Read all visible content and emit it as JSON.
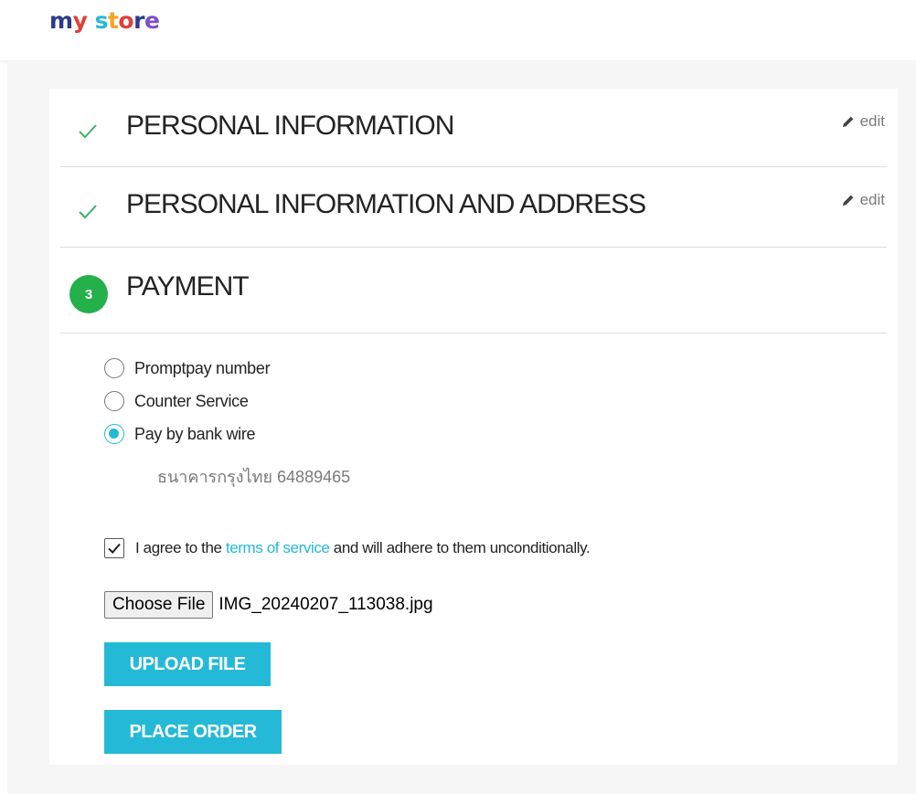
{
  "brand": {
    "logo_letters": [
      {
        "ch": "m",
        "color": "#2b3a8c"
      },
      {
        "ch": "y",
        "color": "#e0403a"
      },
      {
        "ch": " ",
        "color": "#2b3a8c"
      },
      {
        "ch": "s",
        "color": "#24b9d7"
      },
      {
        "ch": "t",
        "color": "#f5a623"
      },
      {
        "ch": "o",
        "color": "#e0403a"
      },
      {
        "ch": "r",
        "color": "#2b3a8c"
      },
      {
        "ch": "e",
        "color": "#7b4fc9"
      }
    ]
  },
  "checkout": {
    "steps": [
      {
        "title": "PERSONAL INFORMATION",
        "status": "complete",
        "icon": "check-icon",
        "edit_label": "edit"
      },
      {
        "title": "PERSONAL INFORMATION AND ADDRESS",
        "status": "complete",
        "icon": "check-icon",
        "edit_label": "edit"
      },
      {
        "title": "PAYMENT",
        "status": "current",
        "number": "3"
      }
    ],
    "payment_options": [
      {
        "label": "Promptpay number",
        "selected": false
      },
      {
        "label": "Counter Service",
        "selected": false
      },
      {
        "label": "Pay by bank wire",
        "selected": true
      }
    ],
    "bank_detail": "ธนาคารกรุงไทย 64889465",
    "terms": {
      "checked": true,
      "text_before": "I agree to the ",
      "link_text": "terms of service",
      "text_after": " and will adhere to them unconditionally."
    },
    "file": {
      "choose_label": "Choose File",
      "file_name": "IMG_20240207_113038.jpg"
    },
    "upload_label": "UPLOAD FILE",
    "place_order_label": "PLACE ORDER"
  },
  "colors": {
    "accent": "#24b9d7",
    "success": "#24b04b",
    "check": "#3eb06a"
  }
}
